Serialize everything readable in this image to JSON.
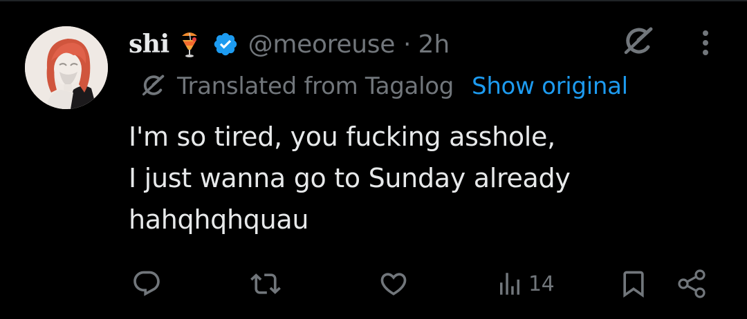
{
  "tweet": {
    "display_name": "shi",
    "name_emoji": "tropical-drink-emoji",
    "handle": "@meoreuse",
    "separator": "·",
    "time_ago": "2h",
    "translation": {
      "label": "Translated from Tagalog",
      "show_original": "Show original"
    },
    "body_lines": [
      "I'm so tired, you fucking asshole,",
      "I just wanna go to Sunday already",
      "hahqhqhquau"
    ],
    "actions": {
      "reply_icon": "reply-icon",
      "retweet_icon": "retweet-icon",
      "like_icon": "heart-icon",
      "views_icon": "views-icon",
      "views_count": "14",
      "bookmark_icon": "bookmark-icon",
      "share_icon": "share-icon"
    },
    "header_icons": {
      "grok": "grok-icon",
      "more": "more-icon",
      "verified": "verified-badge-icon"
    }
  },
  "colors": {
    "background": "#000000",
    "text_primary": "#e7e9ea",
    "text_secondary": "#71767b",
    "link": "#1d9bf0",
    "verified": "#1d9bf0"
  }
}
